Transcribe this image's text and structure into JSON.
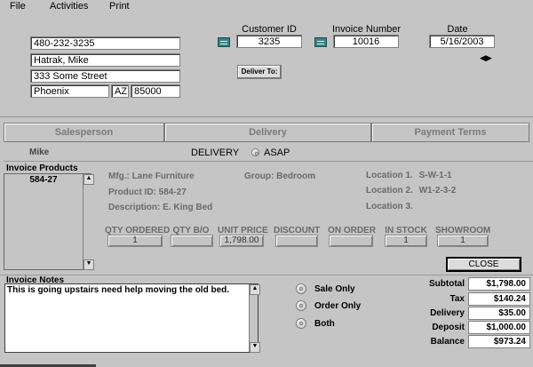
{
  "menu": [
    "File",
    "Activities",
    "Print"
  ],
  "customer": {
    "phone": "480-232-3235",
    "name": "Hatrak, Mike",
    "street": "333 Some Street",
    "city": "Phoenix",
    "state": "AZ",
    "zip": "85000"
  },
  "header": {
    "customer_id_label": "Customer ID",
    "customer_id": "3235",
    "invoice_number_label": "Invoice Number",
    "invoice_number": "10016",
    "date_label": "Date",
    "date": "5/16/2003",
    "deliver_to": "Deliver To:"
  },
  "tabs": [
    "Salesperson",
    "Delivery",
    "Payment Terms"
  ],
  "status": {
    "salesperson": "Mike",
    "delivery": "DELIVERY",
    "asap": "ASAP"
  },
  "products": {
    "title": "Invoice Products",
    "items": [
      "584-27",
      "",
      "",
      "",
      "",
      "",
      ""
    ]
  },
  "details": {
    "mfg_label": "Mfg.:",
    "mfg": "Lane Furniture",
    "group_label": "Group:",
    "group": "Bedroom",
    "product_id_label": "Product ID:",
    "product_id": "584-27",
    "description_label": "Description:",
    "description": "E. King Bed",
    "loc1_label": "Location 1.",
    "loc1": "S-W-1-1",
    "loc2_label": "Location 2.",
    "loc2": "W1-2-3-2",
    "loc3_label": "Location 3.",
    "loc3": ""
  },
  "qty": {
    "headers": [
      "QTY ORDERED",
      "QTY B/O",
      "UNIT PRICE",
      "DISCOUNT",
      "ON ORDER",
      "IN STOCK",
      "SHOWROOM"
    ],
    "values": [
      "1",
      "",
      "1,798.00",
      "",
      "",
      "1",
      "1"
    ]
  },
  "close_label": "CLOSE",
  "notes": {
    "title": "Invoice Notes",
    "text": "This is going upstairs need help moving the old bed."
  },
  "options": [
    "Sale Only",
    "Order Only",
    "Both"
  ],
  "totals": [
    {
      "label": "Subtotal",
      "value": "$1,798.00"
    },
    {
      "label": "Tax",
      "value": "$140.24"
    },
    {
      "label": "Delivery",
      "value": "$35.00"
    },
    {
      "label": "Deposit",
      "value": "$1,000.00"
    },
    {
      "label": "Balance",
      "value": "$973.24"
    }
  ]
}
